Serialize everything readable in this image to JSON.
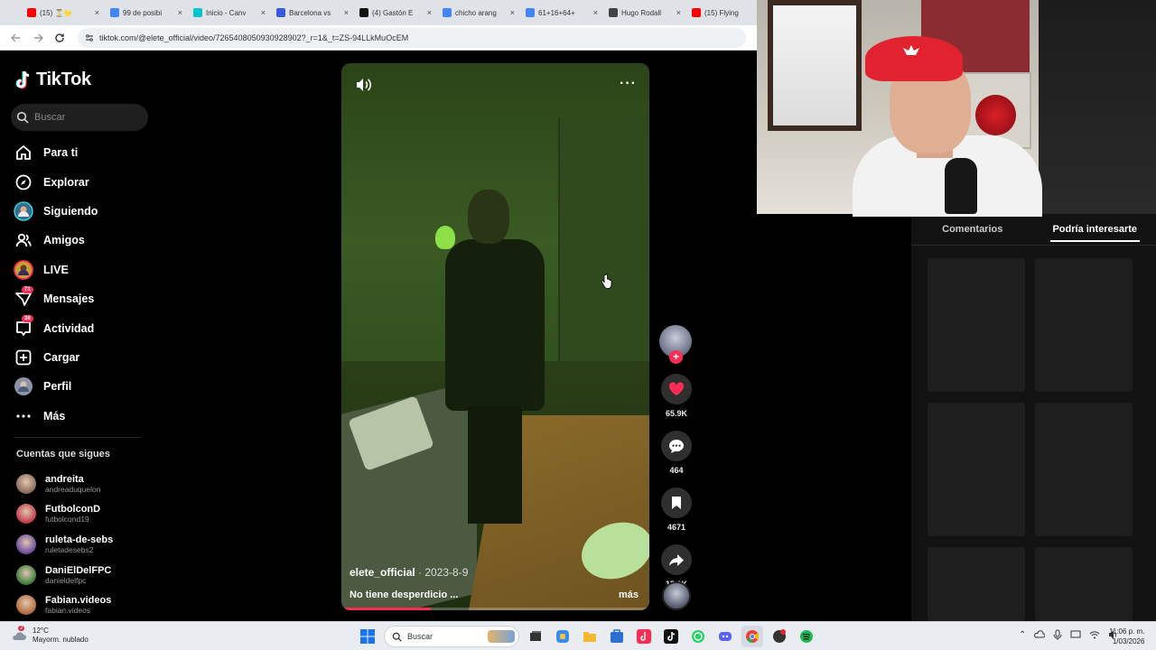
{
  "browser": {
    "tabs": [
      {
        "title": "(15) ⏳🌟",
        "color": "#ff0000"
      },
      {
        "title": "99 de posibi",
        "color": "#4285f4"
      },
      {
        "title": "Inicio - Canv",
        "color": "#00c4cc"
      },
      {
        "title": "Barcelona vs",
        "color": "#3b5bdb"
      },
      {
        "title": "(4) Gastón E",
        "color": "#111111"
      },
      {
        "title": "chicho arang",
        "color": "#4285f4"
      },
      {
        "title": "61+16+64+",
        "color": "#4285f4"
      },
      {
        "title": "Hugo Rodall",
        "color": "#444444"
      },
      {
        "title": "(15) Flying",
        "color": "#ff0000"
      }
    ],
    "url": "tiktok.com/@elete_official/video/7265408050930928902?_r=1&_t=ZS-94LLkMuOcEM"
  },
  "sidebar": {
    "brand": "TikTok",
    "search_placeholder": "Buscar",
    "nav": [
      {
        "label": "Para ti",
        "icon": "home-icon"
      },
      {
        "label": "Explorar",
        "icon": "compass-icon"
      },
      {
        "label": "Siguiendo",
        "icon": "following-avatar-icon"
      },
      {
        "label": "Amigos",
        "icon": "friends-icon"
      },
      {
        "label": "LIVE",
        "icon": "live-icon"
      },
      {
        "label": "Mensajes",
        "icon": "messages-icon",
        "badge": "71"
      },
      {
        "label": "Actividad",
        "icon": "activity-icon",
        "badge": "38"
      },
      {
        "label": "Cargar",
        "icon": "upload-icon"
      },
      {
        "label": "Perfil",
        "icon": "profile-icon"
      },
      {
        "label": "Más",
        "icon": "more-icon"
      }
    ],
    "following_title": "Cuentas que sigues",
    "following": [
      {
        "name": "andreita",
        "handle": "andreaduquelon",
        "color": "#8a6b5a"
      },
      {
        "name": "FutbolconD",
        "handle": "futbolcond19",
        "color": "#c23b4a"
      },
      {
        "name": "ruleta-de-sebs",
        "handle": "ruletadesebs2",
        "color": "#6a4c9c"
      },
      {
        "name": "DaniElDelFPC",
        "handle": "danieldelfpc",
        "color": "#3c7a3c"
      },
      {
        "name": "Fabian.videos",
        "handle": "fabian.videos",
        "color": "#b06a3a"
      }
    ]
  },
  "video": {
    "author": "elete_official",
    "date": " · 2023-8-9",
    "caption": "No tiene desperdicio ...",
    "more_label": "más",
    "progress": 0.29
  },
  "actions": {
    "likes": "65.9K",
    "comments": "464",
    "saves": "4671",
    "shares": "15.1K"
  },
  "right_panel": {
    "tabs": [
      "Comentarios",
      "Podría interesarte"
    ],
    "active_tab": 1
  },
  "taskbar": {
    "weather_temp": "12°C",
    "weather_desc": "Mayorm. nublado",
    "weather_badge": "2",
    "search_placeholder": "Buscar",
    "time": "11:06 p. m.",
    "date": "1/03/2026"
  }
}
